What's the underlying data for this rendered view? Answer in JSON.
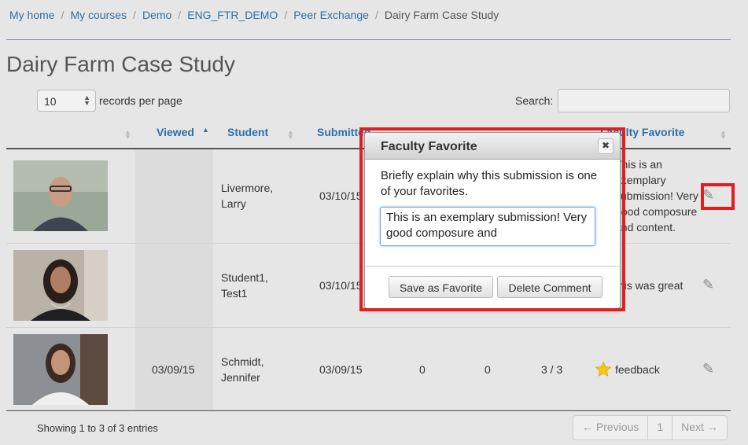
{
  "breadcrumb": {
    "my_home": "My home",
    "my_courses": "My courses",
    "demo": "Demo",
    "course": "ENG_FTR_DEMO",
    "peer_exchange": "Peer Exchange",
    "current": "Dairy Farm Case Study",
    "sep": "/"
  },
  "page_title": "Dairy Farm Case Study",
  "controls": {
    "records_value": "10",
    "records_label": "records per page",
    "search_label": "Search:",
    "search_value": ""
  },
  "columns": {
    "viewed": "Viewed",
    "student": "Student",
    "submitted": "Submitted",
    "favorite": "Faculty Favorite"
  },
  "rows": [
    {
      "viewed": "",
      "student_line1": "Livermore,",
      "student_line2": "Larry",
      "submitted": "03/10/15",
      "col5": "",
      "col6": "",
      "col7": "",
      "favorite_lines": [
        "This is an",
        "exemplary",
        "submission! Very",
        "good composure",
        "and content."
      ]
    },
    {
      "viewed": "",
      "student_line1": "Student1,",
      "student_line2": "Test1",
      "submitted": "03/10/15",
      "col5": "",
      "col6": "",
      "col7": "",
      "favorite_lines": [
        "this was great"
      ]
    },
    {
      "viewed": "03/09/15",
      "student_line1": "Schmidt,",
      "student_line2": "Jennifer",
      "submitted": "03/09/15",
      "col5": "0",
      "col6": "0",
      "col7": "3 / 3",
      "favorite_lines": [
        "feedback"
      ]
    }
  ],
  "footer": {
    "info": "Showing 1 to 3 of 3 entries",
    "previous": "← Previous",
    "page": "1",
    "next": "Next →"
  },
  "modal": {
    "title": "Faculty Favorite",
    "close": "✖",
    "prompt": "Briefly explain why this submission is one of your favorites.",
    "textarea": "This is an exemplary submission! Very good composure and",
    "save": "Save as Favorite",
    "delete": "Delete Comment"
  },
  "colors": {
    "link": "#2f6ea7",
    "highlight": "#e02020",
    "star": "#f5c518"
  },
  "icons": {
    "edit": "pencil-icon",
    "favorite": "star-icon",
    "close": "close-icon",
    "sort": "sort-icon"
  }
}
